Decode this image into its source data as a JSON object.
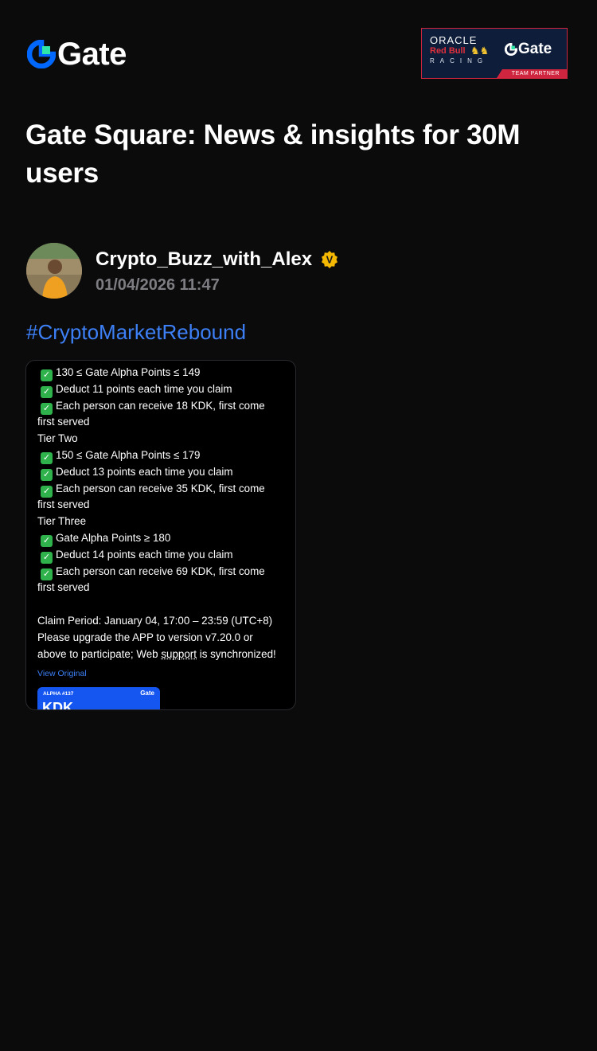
{
  "header": {
    "logo_text": "Gate",
    "logo_icon": "gate-logo-icon",
    "brand_color": "#0068ff",
    "partner_badge": {
      "oracle": "ORACLE",
      "red_bull": "Red Bull",
      "racing": "RACING",
      "gate": "Gate",
      "strip": "TEAM PARTNER"
    }
  },
  "page_title": "Gate Square: News & insights for 30M users",
  "post": {
    "author": "Crypto_Buzz_with_Alex",
    "verified_icon": "verified-badge-icon",
    "verified_mark": "V",
    "timestamp": "01/04/2026 11:47",
    "hashtag": "#CryptoMarketRebound",
    "check_mark": "✓",
    "lines": [
      "130 ≤ Gate Alpha Points ≤ 149",
      "Deduct 11 points each time you claim",
      "Each person can receive 18 KDK, first come",
      "first served",
      "Tier Two",
      "150 ≤ Gate Alpha Points ≤ 179",
      "Deduct 13 points each time you claim",
      "Each person can receive 35 KDK, first come",
      "first served",
      "Tier Three",
      "Gate Alpha Points ≥ 180",
      "Deduct 14 points each time you claim",
      "Each person can receive 69 KDK, first come",
      "first served",
      "",
      "Claim Period: January 04, 17:00 – 23:59 (UTC+8)",
      "Please upgrade the APP to version v7.20.0 or",
      "above to participate; Web ",
      "support",
      " is synchronized!"
    ],
    "view_original": "View Original",
    "thumbnail": {
      "alpha_label": "ALPHA #137",
      "gate_label": "Gate",
      "token": "KDK"
    }
  }
}
